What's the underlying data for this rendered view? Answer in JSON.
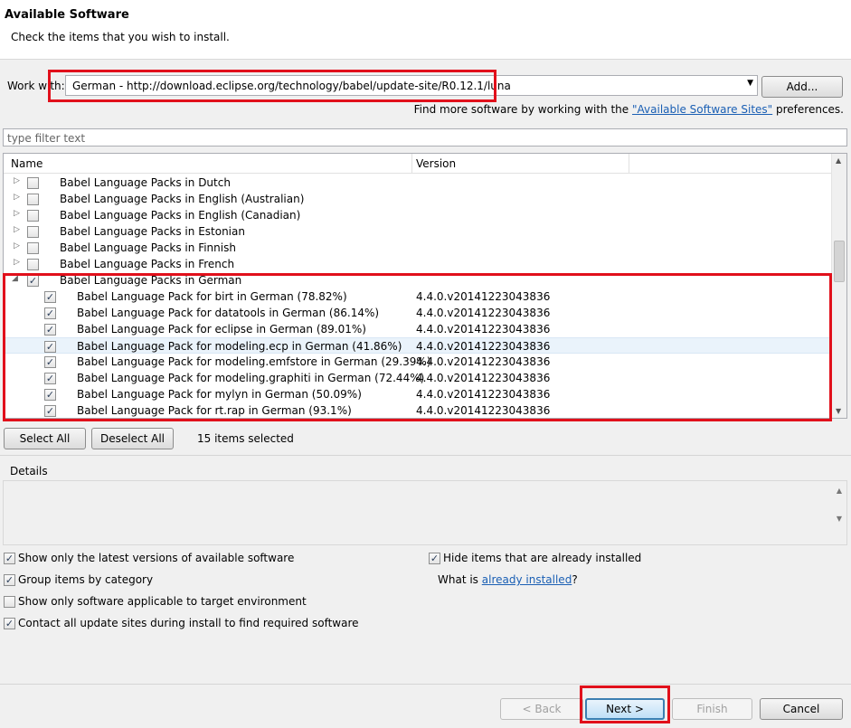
{
  "header": {
    "title": "Available Software",
    "description": "Check the items that you wish to install."
  },
  "work_with": {
    "label": "Work with:",
    "value": "German - http://download.eclipse.org/technology/babel/update-site/R0.12.1/luna",
    "add_button": "Add...",
    "hint_prefix": "Find more software by working with the",
    "hint_link": "\"Available Software Sites\"",
    "hint_suffix": "preferences."
  },
  "filter": {
    "placeholder": "type filter text"
  },
  "table": {
    "columns": [
      "Name",
      "Version"
    ],
    "rows": [
      {
        "name": "Babel Language Packs in Dutch",
        "version": "",
        "level": 0,
        "checked": false,
        "expanded": false
      },
      {
        "name": "Babel Language Packs in English (Australian)",
        "version": "",
        "level": 0,
        "checked": false,
        "expanded": false
      },
      {
        "name": "Babel Language Packs in English (Canadian)",
        "version": "",
        "level": 0,
        "checked": false,
        "expanded": false
      },
      {
        "name": "Babel Language Packs in Estonian",
        "version": "",
        "level": 0,
        "checked": false,
        "expanded": false
      },
      {
        "name": "Babel Language Packs in Finnish",
        "version": "",
        "level": 0,
        "checked": false,
        "expanded": false
      },
      {
        "name": "Babel Language Packs in French",
        "version": "",
        "level": 0,
        "checked": false,
        "expanded": false
      },
      {
        "name": "Babel Language Packs in German",
        "version": "",
        "level": 0,
        "checked": true,
        "expanded": true
      },
      {
        "name": "Babel Language Pack for birt in German (78.82%)",
        "version": "4.4.0.v20141223043836",
        "level": 1,
        "checked": true
      },
      {
        "name": "Babel Language Pack for datatools in German (86.14%)",
        "version": "4.4.0.v20141223043836",
        "level": 1,
        "checked": true
      },
      {
        "name": "Babel Language Pack for eclipse in German (89.01%)",
        "version": "4.4.0.v20141223043836",
        "level": 1,
        "checked": true
      },
      {
        "name": "Babel Language Pack for modeling.ecp in German (41.86%)",
        "version": "4.4.0.v20141223043836",
        "level": 1,
        "checked": true,
        "selected": true
      },
      {
        "name": "Babel Language Pack for modeling.emfstore in German (29.39%)",
        "version": "4.4.0.v20141223043836",
        "level": 1,
        "checked": true
      },
      {
        "name": "Babel Language Pack for modeling.graphiti in German (72.44%)",
        "version": "4.4.0.v20141223043836",
        "level": 1,
        "checked": true
      },
      {
        "name": "Babel Language Pack for mylyn in German (50.09%)",
        "version": "4.4.0.v20141223043836",
        "level": 1,
        "checked": true
      },
      {
        "name": "Babel Language Pack for rt.rap in German (93.1%)",
        "version": "4.4.0.v20141223043836",
        "level": 1,
        "checked": true
      }
    ]
  },
  "selection": {
    "select_all": "Select All",
    "deselect_all": "Deselect All",
    "count": "15 items selected"
  },
  "details": {
    "label": "Details"
  },
  "options": {
    "latest_versions": {
      "label": "Show only the latest versions of available software",
      "checked": true
    },
    "group_by_category": {
      "label": "Group items by category",
      "checked": true
    },
    "target_env": {
      "label": "Show only software applicable to target environment",
      "checked": false
    },
    "contact_sites": {
      "label": "Contact all update sites during install to find required software",
      "checked": true
    },
    "hide_installed": {
      "label": "Hide items that are already installed",
      "checked": true
    },
    "what_is_prefix": "What is",
    "what_is_link": "already installed",
    "what_is_suffix": "?"
  },
  "footer": {
    "back": "< Back",
    "next": "Next >",
    "finish": "Finish",
    "cancel": "Cancel"
  },
  "icons": {
    "checked_glyph": "✓",
    "tree_collapsed": "▷",
    "tree_expanded": "◢",
    "dropdown": "▼"
  },
  "colors": {
    "highlight_red": "#e1101b",
    "link_blue": "#1a5fb4"
  }
}
